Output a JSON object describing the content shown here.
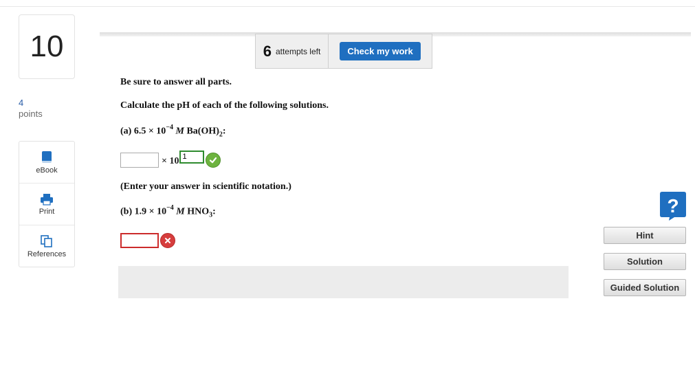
{
  "question": {
    "number": "10",
    "points_value": "4",
    "points_label": "points"
  },
  "tools": [
    {
      "label": "eBook",
      "icon": "book-icon"
    },
    {
      "label": "Print",
      "icon": "printer-icon"
    },
    {
      "label": "References",
      "icon": "copy-icon"
    }
  ],
  "toolbar": {
    "attempts_count": "6",
    "attempts_label": "attempts left",
    "check_label": "Check my work"
  },
  "content": {
    "instruction": "Be sure to answer all parts.",
    "prompt": "Calculate the pH of each of the following solutions.",
    "part_a": {
      "prefix": "(a) 6.5 × 10",
      "exponent": "−4",
      "unit": "M",
      "formula": "Ba(OH)",
      "subscript": "2",
      "suffix": ":"
    },
    "part_a_answer": {
      "mantissa_value": "",
      "times_label": "× 10",
      "exponent_value": "1",
      "status": "correct"
    },
    "note": "(Enter your answer in scientific notation.)",
    "part_b": {
      "prefix": "(b) 1.9 × 10",
      "exponent": "−4",
      "unit": "M",
      "formula": "HNO",
      "subscript": "3",
      "suffix": ":"
    },
    "part_b_answer": {
      "value": "",
      "status": "incorrect"
    }
  },
  "side_buttons": {
    "hint": "Hint",
    "solution": "Solution",
    "guided": "Guided Solution"
  },
  "colors": {
    "accent": "#1f6fc0",
    "correct": "#6db33f",
    "incorrect": "#d63d3d",
    "help": "#1f6fc0"
  }
}
